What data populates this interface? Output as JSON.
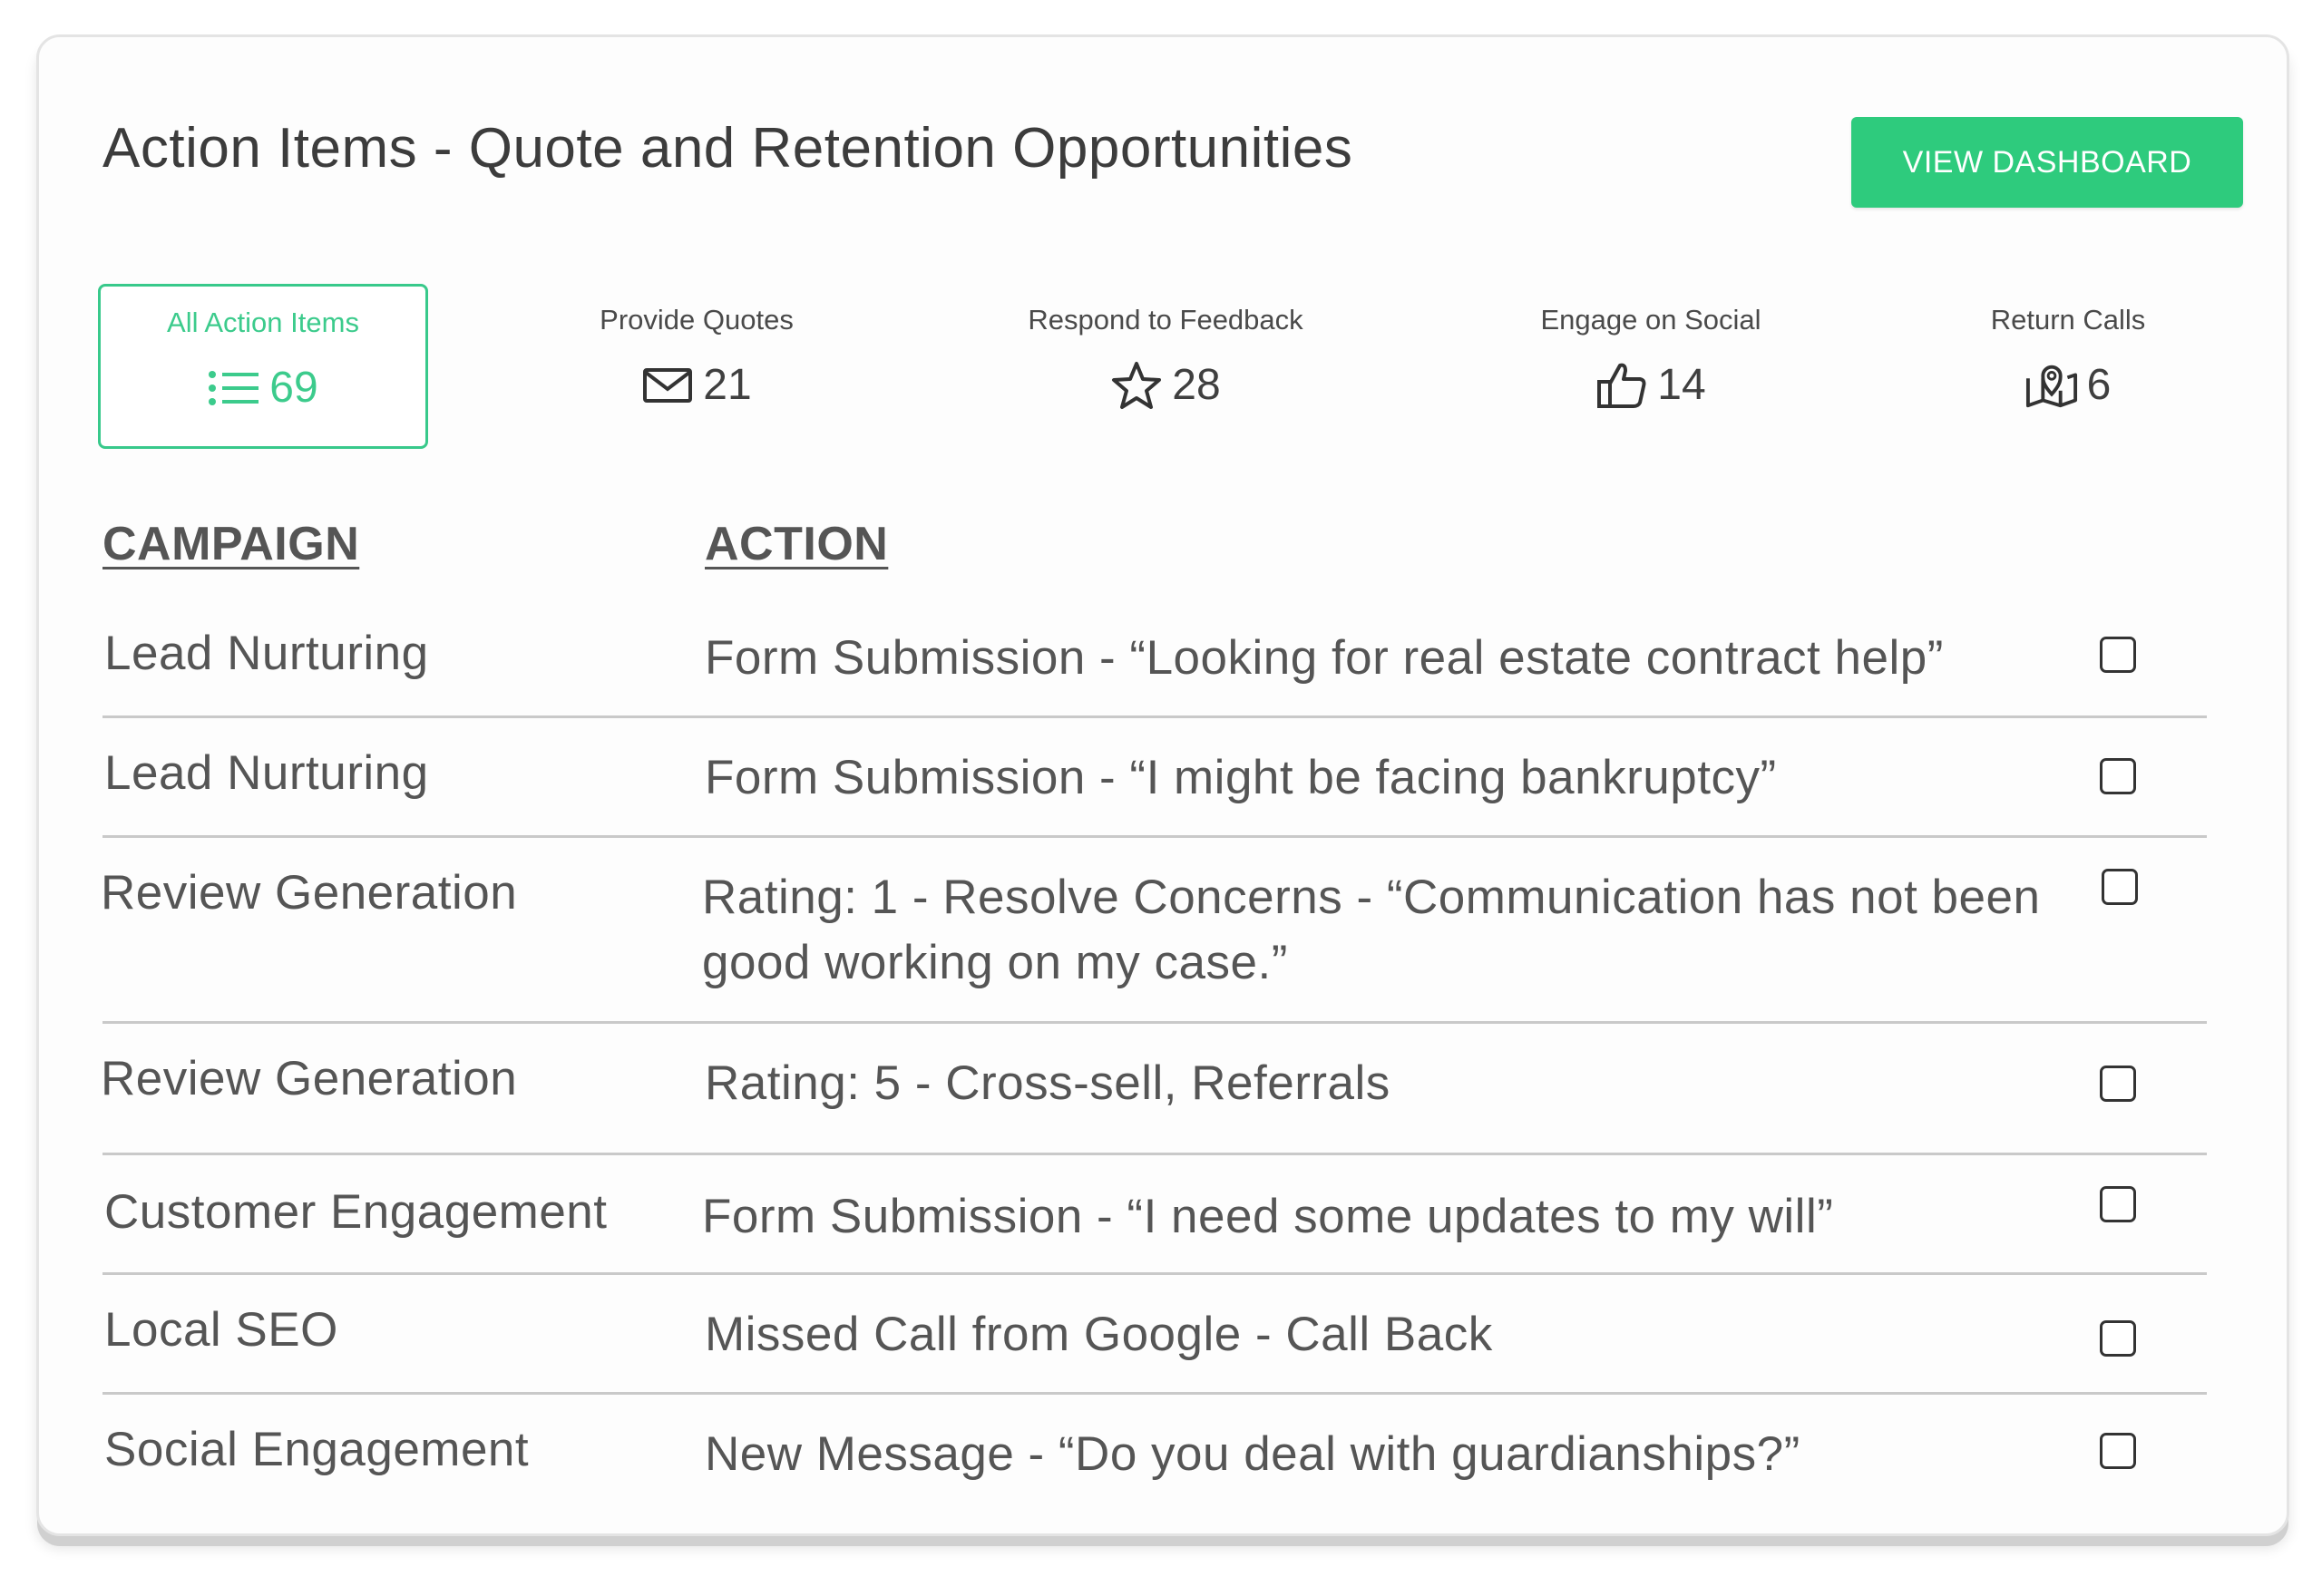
{
  "header": {
    "title": "Action Items - Quote and Retention Opportunities",
    "view_dashboard_label": "VIEW DASHBOARD"
  },
  "tabs": [
    {
      "label": "All Action Items",
      "count": "69",
      "icon": "list-icon",
      "active": true
    },
    {
      "label": "Provide Quotes",
      "count": "21",
      "icon": "envelope-icon",
      "active": false
    },
    {
      "label": "Respond to Feedback",
      "count": "28",
      "icon": "star-icon",
      "active": false
    },
    {
      "label": "Engage on Social",
      "count": "14",
      "icon": "thumbs-up-icon",
      "active": false
    },
    {
      "label": "Return Calls",
      "count": "6",
      "icon": "map-pin-icon",
      "active": false
    }
  ],
  "table": {
    "headers": {
      "campaign": "CAMPAIGN",
      "action": "ACTION"
    },
    "rows": [
      {
        "campaign": "Lead Nurturing",
        "action": "Form Submission - “Looking for real estate contract help”",
        "checked": false
      },
      {
        "campaign": "Lead Nurturing",
        "action": "Form Submission - “I might be facing bankruptcy”",
        "checked": false
      },
      {
        "campaign": "Review Generation",
        "action": "Rating: 1 - Resolve Concerns - “Communication has not been good working on my case.”",
        "checked": false
      },
      {
        "campaign": "Review Generation",
        "action": "Rating: 5 - Cross-sell, Referrals",
        "checked": false
      },
      {
        "campaign": "Customer Engagement",
        "action": "Form Submission - “I need some updates to my will”",
        "checked": false
      },
      {
        "campaign": "Local SEO",
        "action": "Missed Call from Google - Call Back",
        "checked": false
      },
      {
        "campaign": "Social Engagement",
        "action": "New Message - “Do you deal with guardianships?”",
        "checked": false
      }
    ]
  },
  "colors": {
    "accent": "#2ecb7d",
    "active_tab_border": "#38c98b",
    "text": "#555555",
    "divider": "#c9c9c9"
  }
}
